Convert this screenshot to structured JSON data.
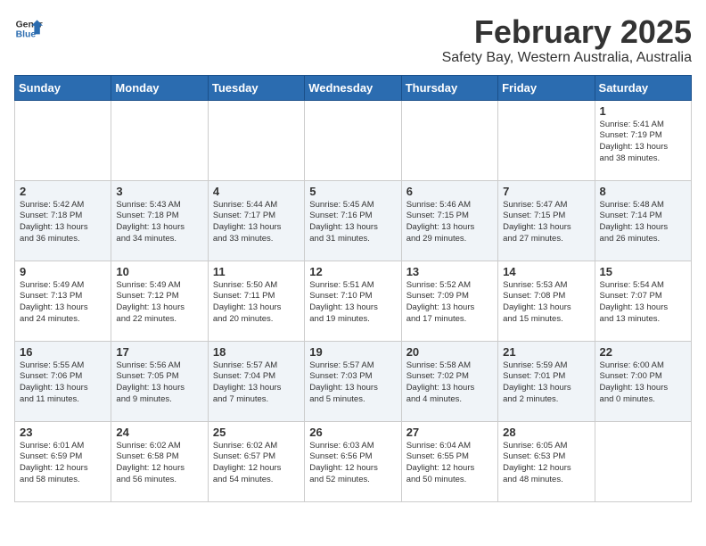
{
  "header": {
    "logo_general": "General",
    "logo_blue": "Blue",
    "title": "February 2025",
    "subtitle": "Safety Bay, Western Australia, Australia"
  },
  "weekdays": [
    "Sunday",
    "Monday",
    "Tuesday",
    "Wednesday",
    "Thursday",
    "Friday",
    "Saturday"
  ],
  "weeks": [
    [
      {
        "day": "",
        "info": ""
      },
      {
        "day": "",
        "info": ""
      },
      {
        "day": "",
        "info": ""
      },
      {
        "day": "",
        "info": ""
      },
      {
        "day": "",
        "info": ""
      },
      {
        "day": "",
        "info": ""
      },
      {
        "day": "1",
        "info": "Sunrise: 5:41 AM\nSunset: 7:19 PM\nDaylight: 13 hours\nand 38 minutes."
      }
    ],
    [
      {
        "day": "2",
        "info": "Sunrise: 5:42 AM\nSunset: 7:18 PM\nDaylight: 13 hours\nand 36 minutes."
      },
      {
        "day": "3",
        "info": "Sunrise: 5:43 AM\nSunset: 7:18 PM\nDaylight: 13 hours\nand 34 minutes."
      },
      {
        "day": "4",
        "info": "Sunrise: 5:44 AM\nSunset: 7:17 PM\nDaylight: 13 hours\nand 33 minutes."
      },
      {
        "day": "5",
        "info": "Sunrise: 5:45 AM\nSunset: 7:16 PM\nDaylight: 13 hours\nand 31 minutes."
      },
      {
        "day": "6",
        "info": "Sunrise: 5:46 AM\nSunset: 7:15 PM\nDaylight: 13 hours\nand 29 minutes."
      },
      {
        "day": "7",
        "info": "Sunrise: 5:47 AM\nSunset: 7:15 PM\nDaylight: 13 hours\nand 27 minutes."
      },
      {
        "day": "8",
        "info": "Sunrise: 5:48 AM\nSunset: 7:14 PM\nDaylight: 13 hours\nand 26 minutes."
      }
    ],
    [
      {
        "day": "9",
        "info": "Sunrise: 5:49 AM\nSunset: 7:13 PM\nDaylight: 13 hours\nand 24 minutes."
      },
      {
        "day": "10",
        "info": "Sunrise: 5:49 AM\nSunset: 7:12 PM\nDaylight: 13 hours\nand 22 minutes."
      },
      {
        "day": "11",
        "info": "Sunrise: 5:50 AM\nSunset: 7:11 PM\nDaylight: 13 hours\nand 20 minutes."
      },
      {
        "day": "12",
        "info": "Sunrise: 5:51 AM\nSunset: 7:10 PM\nDaylight: 13 hours\nand 19 minutes."
      },
      {
        "day": "13",
        "info": "Sunrise: 5:52 AM\nSunset: 7:09 PM\nDaylight: 13 hours\nand 17 minutes."
      },
      {
        "day": "14",
        "info": "Sunrise: 5:53 AM\nSunset: 7:08 PM\nDaylight: 13 hours\nand 15 minutes."
      },
      {
        "day": "15",
        "info": "Sunrise: 5:54 AM\nSunset: 7:07 PM\nDaylight: 13 hours\nand 13 minutes."
      }
    ],
    [
      {
        "day": "16",
        "info": "Sunrise: 5:55 AM\nSunset: 7:06 PM\nDaylight: 13 hours\nand 11 minutes."
      },
      {
        "day": "17",
        "info": "Sunrise: 5:56 AM\nSunset: 7:05 PM\nDaylight: 13 hours\nand 9 minutes."
      },
      {
        "day": "18",
        "info": "Sunrise: 5:57 AM\nSunset: 7:04 PM\nDaylight: 13 hours\nand 7 minutes."
      },
      {
        "day": "19",
        "info": "Sunrise: 5:57 AM\nSunset: 7:03 PM\nDaylight: 13 hours\nand 5 minutes."
      },
      {
        "day": "20",
        "info": "Sunrise: 5:58 AM\nSunset: 7:02 PM\nDaylight: 13 hours\nand 4 minutes."
      },
      {
        "day": "21",
        "info": "Sunrise: 5:59 AM\nSunset: 7:01 PM\nDaylight: 13 hours\nand 2 minutes."
      },
      {
        "day": "22",
        "info": "Sunrise: 6:00 AM\nSunset: 7:00 PM\nDaylight: 13 hours\nand 0 minutes."
      }
    ],
    [
      {
        "day": "23",
        "info": "Sunrise: 6:01 AM\nSunset: 6:59 PM\nDaylight: 12 hours\nand 58 minutes."
      },
      {
        "day": "24",
        "info": "Sunrise: 6:02 AM\nSunset: 6:58 PM\nDaylight: 12 hours\nand 56 minutes."
      },
      {
        "day": "25",
        "info": "Sunrise: 6:02 AM\nSunset: 6:57 PM\nDaylight: 12 hours\nand 54 minutes."
      },
      {
        "day": "26",
        "info": "Sunrise: 6:03 AM\nSunset: 6:56 PM\nDaylight: 12 hours\nand 52 minutes."
      },
      {
        "day": "27",
        "info": "Sunrise: 6:04 AM\nSunset: 6:55 PM\nDaylight: 12 hours\nand 50 minutes."
      },
      {
        "day": "28",
        "info": "Sunrise: 6:05 AM\nSunset: 6:53 PM\nDaylight: 12 hours\nand 48 minutes."
      },
      {
        "day": "",
        "info": ""
      }
    ]
  ]
}
